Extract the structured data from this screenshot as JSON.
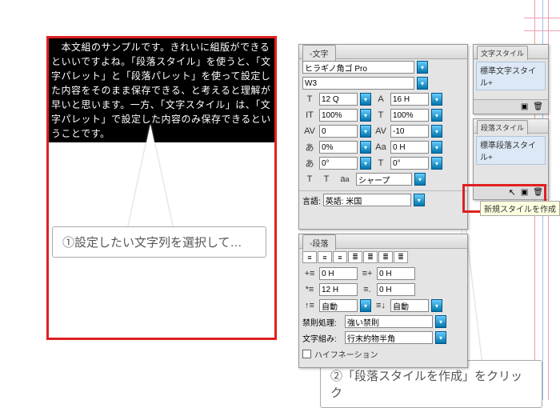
{
  "doc": {
    "body_text": "　本文組のサンプルです。きれいに組版ができるといいですよね。「段落スタイル」を使うと、「文字パレット」と「段落パレット」を使って設定した内容をそのまま保存できる、と考えると理解が早いと思います。一方、「文字スタイル」は、「文字パレット」で設定した内容のみ保存できるということです。"
  },
  "callouts": {
    "step1": "①設定したい文字列を選択して…",
    "step2": "②「段落スタイルを作成」をクリック"
  },
  "char_panel": {
    "tab": "◦文字",
    "font": "ヒラギノ角ゴ Pro",
    "weight": "W3",
    "size": "12 Q",
    "leading": "16 H",
    "hscale": "100%",
    "vscale": "100%",
    "kern": "0",
    "tracking": "-10",
    "tsume": "0%",
    "baseline": "0 H",
    "skew": "0°",
    "rotate": "0°",
    "type_method": "シャープ",
    "lang_label": "言語:",
    "lang": "英語: 米国"
  },
  "para_panel": {
    "tab": "◦段落",
    "indent_left": "0 H",
    "indent_right": "0 H",
    "first_line": "12 H",
    "drop": "0 H",
    "before": "自動",
    "after": "自動",
    "kinsoku_label": "禁則処理:",
    "kinsoku": "強い禁則",
    "mojikumi_label": "文字組み:",
    "mojikumi": "行末約物半角",
    "hyphenate": "ハイフネーション"
  },
  "char_style_panel": {
    "tab": "文字スタイル",
    "default": "標準文字スタイル+"
  },
  "para_style_panel": {
    "tab": "段落スタイル",
    "default": "標準段落スタイル+"
  },
  "tooltip": "新規スタイルを作成",
  "icons": {
    "dropdown": "▾",
    "trash": "🗑",
    "newdoc": "▣",
    "cursor": "↖"
  }
}
